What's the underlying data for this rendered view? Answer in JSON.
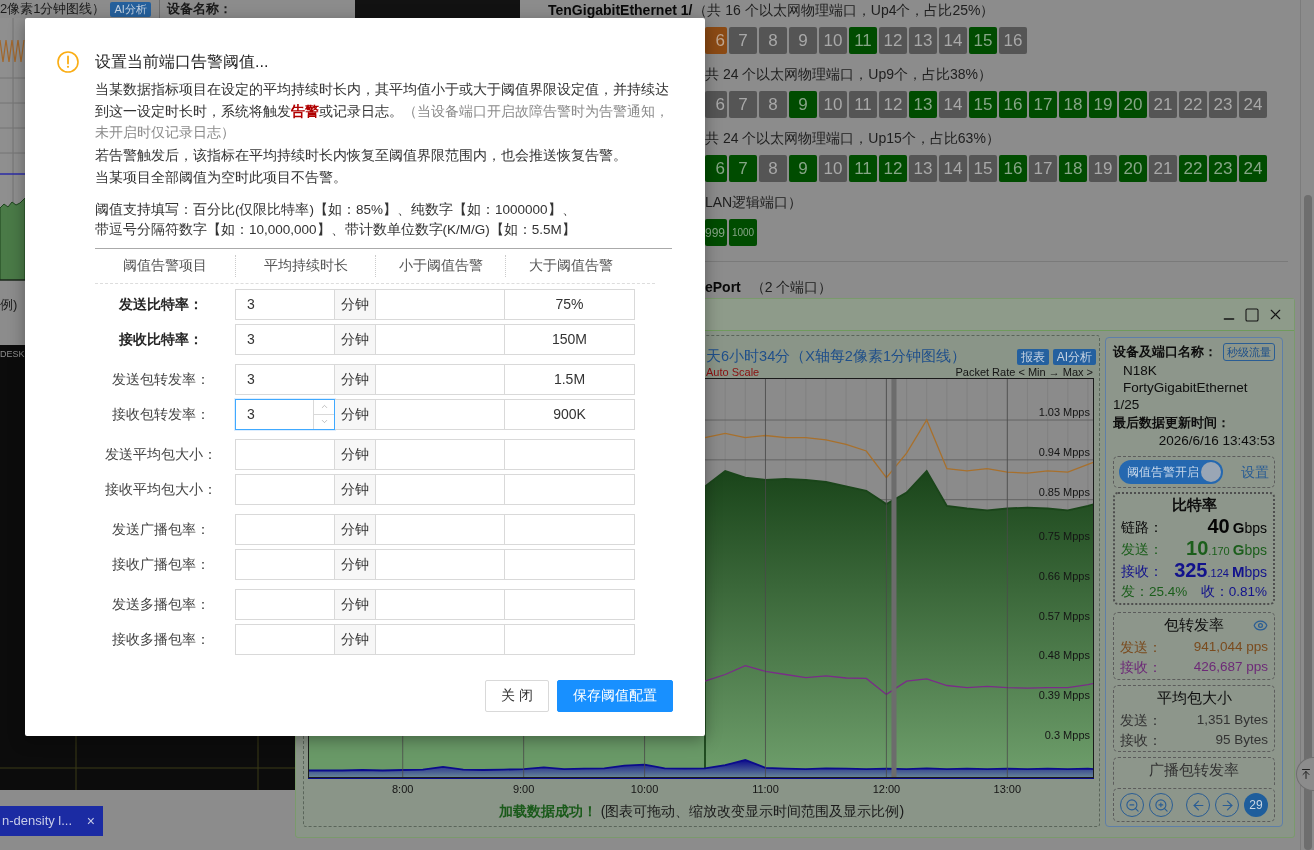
{
  "top_strip": {
    "chart_caption": "2像素1分钟图线）",
    "ai_button": "AI分析",
    "device_label": "设备名称："
  },
  "left_panel": {
    "caption_fragment": "例)",
    "console_text": "DESK",
    "taskbar_tab": {
      "label": "n-density l...",
      "close": "×"
    }
  },
  "port_list": {
    "groups": [
      {
        "name": "TenGigabitEthernet 1/",
        "summary": "（共 16 个以太网物理端口，Up4个，占比25%）",
        "ports": [
          {
            "label": "6",
            "color": "#8b4a14"
          },
          {
            "label": "7",
            "color": "#555555"
          },
          {
            "label": "8",
            "color": "#555555"
          },
          {
            "label": "9",
            "color": "#555555"
          },
          {
            "label": "10",
            "color": "#555555"
          },
          {
            "label": "11",
            "color": "#004c00"
          },
          {
            "label": "12",
            "color": "#555555"
          },
          {
            "label": "13",
            "color": "#555555"
          },
          {
            "label": "14",
            "color": "#555555"
          },
          {
            "label": "15",
            "color": "#004c00"
          },
          {
            "label": "16",
            "color": "#555555"
          }
        ]
      },
      {
        "summary": "共 24 个以太网物理端口，Up9个，占比38%）",
        "ports": [
          {
            "label": "6",
            "color": "#555555"
          },
          {
            "label": "7",
            "color": "#555555"
          },
          {
            "label": "8",
            "color": "#555555"
          },
          {
            "label": "9",
            "color": "#004c00"
          },
          {
            "label": "10",
            "color": "#555555"
          },
          {
            "label": "11",
            "color": "#555555"
          },
          {
            "label": "12",
            "color": "#555555"
          },
          {
            "label": "13",
            "color": "#004c00"
          },
          {
            "label": "14",
            "color": "#555555"
          },
          {
            "label": "15",
            "color": "#004c00"
          },
          {
            "label": "16",
            "color": "#004c00"
          },
          {
            "label": "17",
            "color": "#004c00"
          },
          {
            "label": "18",
            "color": "#004c00"
          },
          {
            "label": "19",
            "color": "#004c00"
          },
          {
            "label": "20",
            "color": "#004c00"
          },
          {
            "label": "21",
            "color": "#555555"
          },
          {
            "label": "22",
            "color": "#555555"
          },
          {
            "label": "23",
            "color": "#555555"
          },
          {
            "label": "24",
            "color": "#555555"
          }
        ]
      },
      {
        "summary": "共 24 个以太网物理端口，Up15个，占比63%）",
        "ports": [
          {
            "label": "6",
            "color": "#004c00"
          },
          {
            "label": "7",
            "color": "#004c00"
          },
          {
            "label": "8",
            "color": "#555555"
          },
          {
            "label": "9",
            "color": "#004c00"
          },
          {
            "label": "10",
            "color": "#555555"
          },
          {
            "label": "11",
            "color": "#004c00"
          },
          {
            "label": "12",
            "color": "#004c00"
          },
          {
            "label": "13",
            "color": "#555555"
          },
          {
            "label": "14",
            "color": "#555555"
          },
          {
            "label": "15",
            "color": "#555555"
          },
          {
            "label": "16",
            "color": "#004c00"
          },
          {
            "label": "17",
            "color": "#555555"
          },
          {
            "label": "18",
            "color": "#004c00"
          },
          {
            "label": "19",
            "color": "#555555"
          },
          {
            "label": "20",
            "color": "#004c00"
          },
          {
            "label": "21",
            "color": "#555555"
          },
          {
            "label": "22",
            "color": "#004c00"
          },
          {
            "label": "23",
            "color": "#004c00"
          },
          {
            "label": "24",
            "color": "#004c00"
          }
        ]
      },
      {
        "summary": "LAN逻辑端口）",
        "ports": [
          {
            "label": "999",
            "color": "#004c00"
          },
          {
            "label": "1000",
            "color": "#004c00"
          }
        ]
      }
    ],
    "next_section": {
      "name": "ePort",
      "summary": "（2 个端口）"
    }
  },
  "traffic_window": {
    "chart_panel": {
      "title": "天6小时34分（X轴每2像素1分钟图线）",
      "buttons": [
        "报表",
        "AI分析"
      ],
      "scale_mode": "Auto Scale",
      "axis_hint": "Packet Rate < Min → Max >",
      "status": "加载数据成功！",
      "hint": "(图表可拖动、缩放改变显示时间范围及显示比例)",
      "chart_data": {
        "type": "line",
        "x": [
          433,
          440,
          450,
          460,
          470,
          480,
          490,
          500,
          510,
          520,
          530,
          540,
          550,
          560,
          570,
          580,
          590,
          600,
          610,
          620,
          630,
          640,
          650,
          660,
          670,
          680,
          690,
          700,
          710,
          720,
          730,
          740,
          750,
          760,
          770,
          780,
          790,
          800,
          810,
          820,
          823
        ],
        "xlim": [
          433,
          823
        ],
        "ylim": [
          0.221,
          1.125
        ],
        "grid": true,
        "xticks": [
          {
            "value": 480,
            "label": "8:00"
          },
          {
            "value": 540,
            "label": "9:00"
          },
          {
            "value": 600,
            "label": "10:00"
          },
          {
            "value": 660,
            "label": "11:00"
          },
          {
            "value": 720,
            "label": "12:00"
          },
          {
            "value": 780,
            "label": "13:00"
          }
        ],
        "yticks": [
          {
            "value": 1.03,
            "label": "1.03 Mpps"
          },
          {
            "value": 0.94,
            "label": "0.94 Mpps"
          },
          {
            "value": 0.85,
            "label": "0.85 Mpps"
          },
          {
            "value": 0.75,
            "label": "0.75 Mpps"
          },
          {
            "value": 0.66,
            "label": "0.66 Mpps"
          },
          {
            "value": 0.57,
            "label": "0.57 Mpps"
          },
          {
            "value": 0.48,
            "label": "0.48 Mpps"
          },
          {
            "value": 0.39,
            "label": "0.39 Mpps"
          },
          {
            "value": 0.3,
            "label": "0.3 Mpps"
          }
        ],
        "series": [
          {
            "type": "area",
            "color": "#1a451a",
            "values": [
              null,
              null,
              null,
              null,
              null,
              null,
              null,
              null,
              null,
              null,
              null,
              null,
              null,
              null,
              null,
              null,
              null,
              null,
              null,
              null,
              0.88,
              0.915,
              0.9,
              0.895,
              0.897,
              0.895,
              0.89,
              0.88,
              0.87,
              0.84,
              0.866,
              0.915,
              0.836,
              0.83,
              0.826,
              0.83,
              0.832,
              0.83,
              0.826,
              0.836,
              0.84
            ]
          },
          {
            "type": "area",
            "color": "#0b0b8c",
            "values": [
              0.238,
              0.238,
              0.238,
              0.239,
              0.238,
              0.239,
              0.24,
              0.246,
              0.24,
              0.239,
              0.24,
              0.241,
              0.245,
              0.241,
              0.242,
              0.243,
              0.249,
              0.251,
              0.243,
              0.242,
              0.243,
              0.25,
              0.262,
              0.244,
              0.242,
              0.241,
              0.243,
              0.242,
              0.241,
              0.242,
              0.241,
              0.243,
              0.241,
              0.242,
              0.241,
              0.242,
              0.241,
              0.242,
              0.241,
              0.242,
              0.241
            ]
          },
          {
            "color": "#a8702c",
            "values": [
              null,
              null,
              null,
              null,
              null,
              null,
              null,
              null,
              null,
              null,
              null,
              null,
              null,
              null,
              null,
              null,
              null,
              null,
              null,
              null,
              0.99,
              1.0,
              0.99,
              0.995,
              0.99,
              0.99,
              0.985,
              0.975,
              0.96,
              0.9,
              0.955,
              1.03,
              0.92,
              0.915,
              0.92,
              0.912,
              0.91,
              0.915,
              0.912,
              0.93,
              0.935
            ]
          },
          {
            "color": "#7a2c88",
            "values": [
              null,
              null,
              null,
              null,
              null,
              null,
              null,
              null,
              null,
              null,
              null,
              null,
              null,
              null,
              null,
              null,
              null,
              null,
              null,
              null,
              0.44,
              0.455,
              0.475,
              0.462,
              0.455,
              0.448,
              0.452,
              0.447,
              0.446,
              0.41,
              0.44,
              0.445,
              0.43,
              0.425,
              0.428,
              0.425,
              0.424,
              0.425,
              0.425,
              0.432,
              0.435
            ]
          }
        ],
        "bands": [
          {
            "axis": "x",
            "from": 722.5,
            "to": 725,
            "color": "#6c6c6c"
          }
        ]
      }
    },
    "info_panel": {
      "device_label": "设备及端口名称：",
      "realtime_button": "秒级流量",
      "device": "N18K",
      "port": "FortyGigabitEthernet 1/25",
      "update_label": "最后数据更新时间：",
      "update_time": "2026/6/16 13:43:53",
      "alarm_toggle": {
        "label": "阈值告警开启",
        "on": true
      },
      "settings_link": "设置",
      "bit_rate": {
        "title": "比特率",
        "rows": [
          {
            "label": "链路：",
            "integer": "40",
            "prefix": "G",
            "unit": "bps",
            "color": "#050505"
          },
          {
            "label": "发送：",
            "integer": "10",
            "fraction": ".170",
            "prefix": "G",
            "unit": "bps",
            "color": "#1b5e1b"
          },
          {
            "label": "接收：",
            "integer": "325",
            "fraction": ".124",
            "prefix": "M",
            "unit": "bps",
            "color": "#12128c"
          }
        ],
        "shares": [
          {
            "label": "发：",
            "value": "25.4%",
            "color": "#1b5e1b"
          },
          {
            "label": "收：",
            "value": "0.81%",
            "color": "#12128c"
          }
        ]
      },
      "packet_rate": {
        "title": "包转发率",
        "rows": [
          {
            "label": "发送：",
            "value": "941,044 pps",
            "color": "#7a4b1e"
          },
          {
            "label": "接收：",
            "value": "426,687 pps",
            "color": "#6d2a77"
          }
        ]
      },
      "avg_packet_size": {
        "title": "平均包大小",
        "rows": [
          {
            "label": "发送：",
            "value": "1,351 Bytes"
          },
          {
            "label": "接收：",
            "value": "95 Bytes"
          }
        ]
      },
      "broadcast_rate": {
        "title": "广播包转发率"
      },
      "page_badge": "29"
    }
  },
  "threshold_dialog": {
    "title": "设置当前端口告警阈值...",
    "description": {
      "text": "当某数据指标项目在设定的平均持续时长内，其平均值小于或大于阈值界限设定值，并持续达到这一设定时长时，系统将触发",
      "highlight": "告警",
      "text_after": "或记录日志。",
      "note": "（当设备端口开启故障告警时为告警通知，未开启时仅记录日志）"
    },
    "notes": [
      "若告警触发后，该指标在平均持续时长内恢复至阈值界限范围内，也会推送恢复告警。",
      "当某项目全部阈值为空时此项目不告警。"
    ],
    "format_hint": [
      "阈值支持填写：百分比(仅限比特率)【如：85%】、纯数字【如：1000000】、",
      "带逗号分隔符数字【如：10,000,000】、带计数单位数字(K/M/G)【如：5.5M】"
    ],
    "columns": [
      "阈值告警项目",
      "平均持续时长",
      "小于阈值告警",
      "大于阈值告警"
    ],
    "row_groups": [
      {
        "rows": [
          {
            "label": "发送比特率：",
            "emphasized": true,
            "duration": "3",
            "unit": "分钟",
            "above": "75%",
            "focused": false
          },
          {
            "label": "接收比特率：",
            "emphasized": true,
            "duration": "3",
            "unit": "分钟",
            "above": "150M",
            "focused": false
          }
        ]
      },
      {
        "rows": [
          {
            "label": "发送包转发率：",
            "emphasized": false,
            "duration": "3",
            "unit": "分钟",
            "above": "1.5M",
            "focused": false
          },
          {
            "label": "接收包转发率：",
            "emphasized": false,
            "duration": "3",
            "unit": "分钟",
            "above": "900K",
            "focused": true
          }
        ]
      },
      {
        "rows": [
          {
            "label": "发送平均包大小：",
            "emphasized": false,
            "unit": "分钟",
            "focused": false
          },
          {
            "label": "接收平均包大小：",
            "emphasized": false,
            "unit": "分钟",
            "focused": false
          }
        ]
      },
      {
        "rows": [
          {
            "label": "发送广播包率：",
            "emphasized": false,
            "unit": "分钟",
            "focused": false
          },
          {
            "label": "接收广播包率：",
            "emphasized": false,
            "unit": "分钟",
            "focused": false
          }
        ]
      },
      {
        "rows": [
          {
            "label": "发送多播包率：",
            "emphasized": false,
            "unit": "分钟",
            "focused": false
          },
          {
            "label": "接收多播包率：",
            "emphasized": false,
            "unit": "分钟",
            "focused": false
          }
        ]
      }
    ],
    "buttons": [
      {
        "label": "关 闭",
        "kind": "secondary"
      },
      {
        "label": "保存阈值配置",
        "kind": "primary"
      }
    ]
  }
}
